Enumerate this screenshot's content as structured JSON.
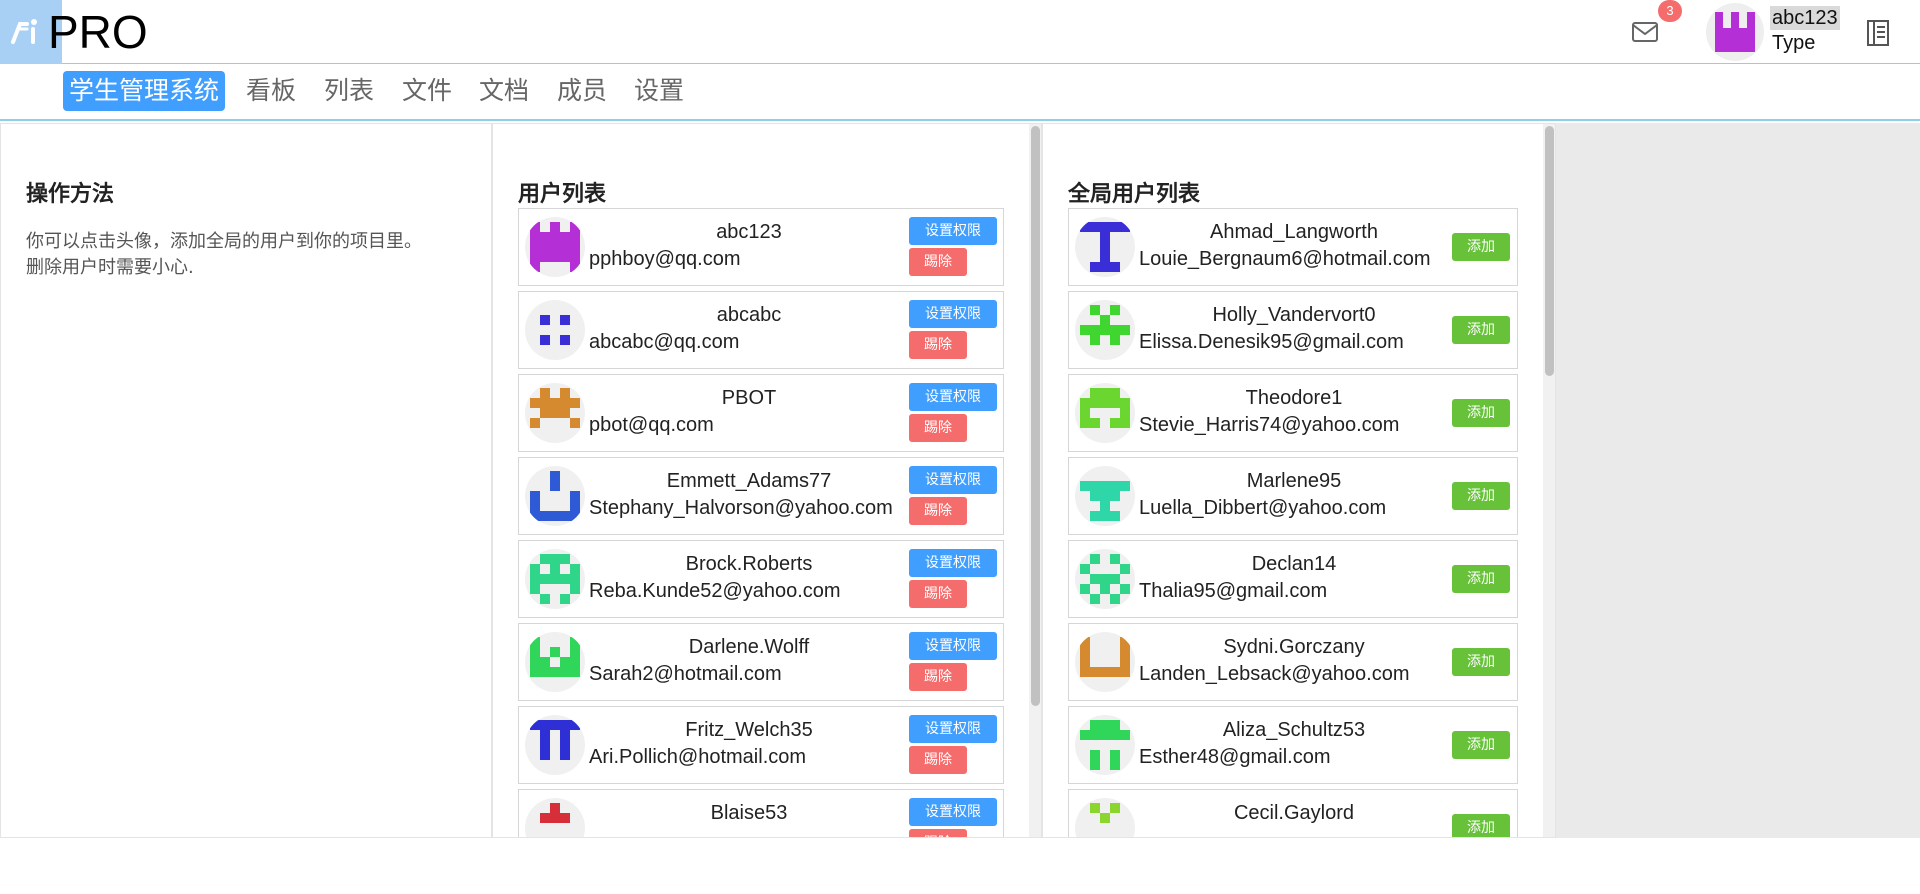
{
  "header": {
    "logo_text": "PRO",
    "unread_count": "3",
    "user_name": "abc123",
    "user_type": "Type"
  },
  "nav": {
    "items": [
      "学生管理系统",
      "看板",
      "列表",
      "文件",
      "文档",
      "成员",
      "设置"
    ]
  },
  "help": {
    "title": "操作方法",
    "line1": "你可以点击头像，添加全局的用户到你的项目里。",
    "line2": "删除用户时需要小心."
  },
  "project_users": {
    "title": "用户列表",
    "perm_label": "设置权限",
    "remove_label": "踢除",
    "items": [
      {
        "name": "abc123",
        "email": "pphboy@qq.com",
        "color": "#b52fd6"
      },
      {
        "name": "abcabc",
        "email": "abcabc@qq.com",
        "color": "#3a2fd6"
      },
      {
        "name": "PBOT",
        "email": "pbot@qq.com",
        "color": "#d68a2f"
      },
      {
        "name": "Emmett_Adams77",
        "email": "Stephany_Halvorson@yahoo.com",
        "color": "#2f5ad6"
      },
      {
        "name": "Brock.Roberts",
        "email": "Reba.Kunde52@yahoo.com",
        "color": "#2fd68a"
      },
      {
        "name": "Darlene.Wolff",
        "email": "Sarah2@hotmail.com",
        "color": "#2fd65a"
      },
      {
        "name": "Fritz_Welch35",
        "email": "Ari.Pollich@hotmail.com",
        "color": "#2f2fd6"
      },
      {
        "name": "Blaise53",
        "email": "",
        "color": "#d62f3a"
      }
    ]
  },
  "global_users": {
    "title": "全局用户列表",
    "add_label": "添加",
    "items": [
      {
        "name": "Ahmad_Langworth",
        "email": "Louie_Bergnaum6@hotmail.com",
        "color": "#3a2fd6"
      },
      {
        "name": "Holly_Vandervort0",
        "email": "Elissa.Denesik95@gmail.com",
        "color": "#3ed62f"
      },
      {
        "name": "Theodore1",
        "email": "Stevie_Harris74@yahoo.com",
        "color": "#6ad62f"
      },
      {
        "name": "Marlene95",
        "email": "Luella_Dibbert@yahoo.com",
        "color": "#2fd6a8"
      },
      {
        "name": "Declan14",
        "email": "Thalia95@gmail.com",
        "color": "#2fd68a"
      },
      {
        "name": "Sydni.Gorczany",
        "email": "Landen_Lebsack@yahoo.com",
        "color": "#d68a2f"
      },
      {
        "name": "Aliza_Schultz53",
        "email": "Esther48@gmail.com",
        "color": "#2fd65a"
      },
      {
        "name": "Cecil.Gaylord",
        "email": "",
        "color": "#8ad62f"
      }
    ]
  }
}
